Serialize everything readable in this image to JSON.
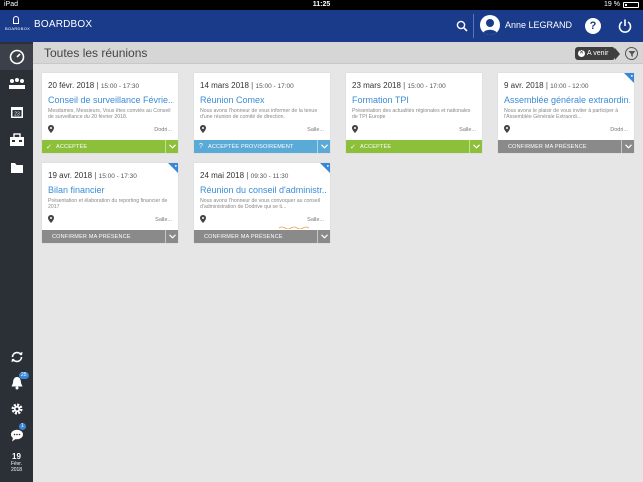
{
  "status_bar": {
    "left": "iPad",
    "time": "11:25",
    "battery": "19 %"
  },
  "header": {
    "logo_text": "BOARDBOX",
    "app_title": "BOARDBOX",
    "user_name": "Anne LEGRAND",
    "help_label": "?",
    "colors": {
      "header_bg": "#1a3a8a",
      "accent": "#3b8cd6"
    }
  },
  "sidebar": {
    "items": [
      {
        "icon": "dashboard-gauge-icon"
      },
      {
        "icon": "meetings-people-icon"
      },
      {
        "icon": "calendar-icon"
      },
      {
        "icon": "toolbox-icon"
      },
      {
        "icon": "folder-icon"
      }
    ],
    "bottom": [
      {
        "icon": "sync-icon"
      },
      {
        "icon": "bell-icon",
        "badge": "25"
      },
      {
        "icon": "gear-icon"
      },
      {
        "icon": "chat-icon",
        "badge": "1"
      }
    ],
    "date": {
      "day": "19",
      "month": "Févr.",
      "year": "2018"
    }
  },
  "main": {
    "title": "Toutes les réunions",
    "filter_label": "A venir",
    "cards": [
      {
        "date": "20 févr. 2018",
        "time": "15:00 - 17:30",
        "title": "Conseil de surveillance Févrie...",
        "desc": "Mesdames, Messieurs, Vous êtes conviés au Conseil de surveillance du 20 février 2018.",
        "location": "Dodri...",
        "status": "Acceptée",
        "status_type": "green",
        "status_icon": "✓",
        "new": false
      },
      {
        "date": "14 mars 2018",
        "time": "15:00 - 17:00",
        "title": "Réunion Comex",
        "desc": "Nous avons l'honneur de vous informer de la tenue d'une réunion de comité de direction.",
        "location": "Salle...",
        "status": "Acceptée provisoirement",
        "status_type": "blue",
        "status_icon": "?",
        "new": false
      },
      {
        "date": "23 mars 2018",
        "time": "15:00 - 17:00",
        "title": "Formation TPI",
        "desc": "Présentation des actualités régionales et nationales de TPI Europe",
        "location": "Salle...",
        "status": "Acceptée",
        "status_type": "green",
        "status_icon": "✓",
        "new": false
      },
      {
        "date": "9 avr. 2018",
        "time": "10:00 - 12:00",
        "title": "Assemblée générale extraordin...",
        "desc": "Nous avons le plaisir de vous inviter à participer à l'Assemblée Générale Extraordi...",
        "location": "Dodri...",
        "status": "Confirmer ma présence",
        "status_type": "gray",
        "status_icon": "",
        "new": true
      },
      {
        "date": "19 avr. 2018",
        "time": "15:00 - 17:30",
        "title": "Bilan financier",
        "desc": "Présentation et élaboration du reporting financier de 2017",
        "location": "Salle...",
        "status": "Confirmer ma présence",
        "status_type": "gray",
        "status_icon": "",
        "new": true
      },
      {
        "date": "24 mai 2018",
        "time": "09:30 - 11:30",
        "title": "Réunion du conseil d'administr...",
        "desc": "Nous avons l'honneur de vous convoquer au conseil d'administration de Dodrive qui se ti...",
        "location": "Salle...",
        "status": "Confirmer ma présence",
        "status_type": "gray",
        "status_icon": "",
        "new": true
      }
    ]
  }
}
